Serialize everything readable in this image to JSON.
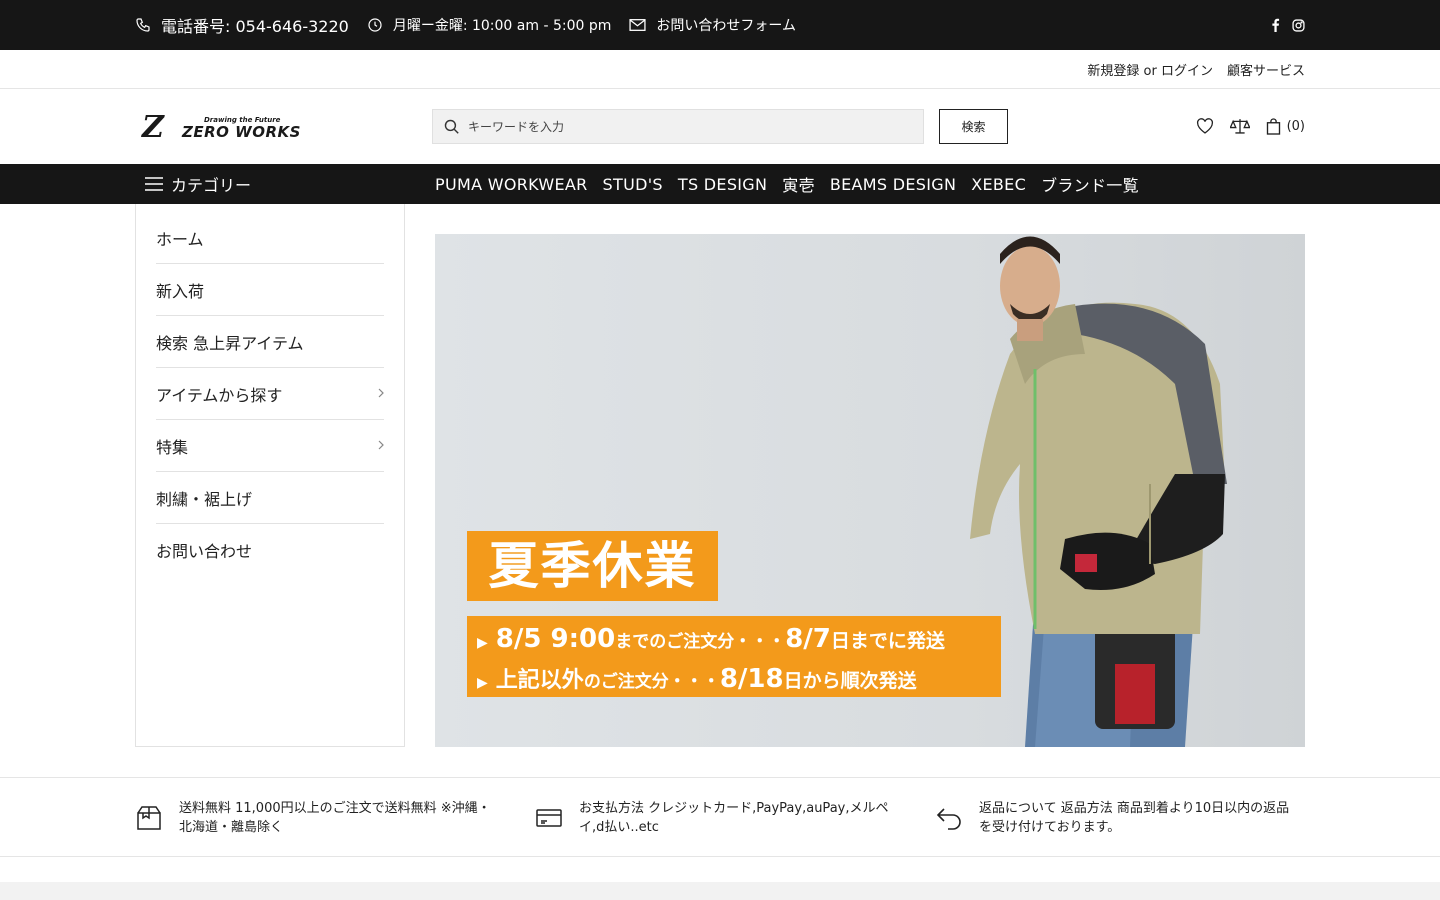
{
  "topbar": {
    "phone": "電話番号: 054-646-3220",
    "hours": "月曜ー金曜: 10:00 am - 5:00 pm",
    "contact": "お問い合わせフォーム"
  },
  "account": {
    "register_login": "新規登録 or ログイン",
    "customer_service": "顧客サービス"
  },
  "logo": {
    "tagline": "Drawing the Future",
    "wordmark": "ZERO WORKS",
    "mark": "Z"
  },
  "search": {
    "placeholder": "キーワードを入力",
    "button": "検索"
  },
  "cart": {
    "count": "(0)"
  },
  "nav": {
    "category_label": "カテゴリー",
    "links": [
      "PUMA WORKWEAR",
      "STUD'S",
      "TS DESIGN",
      "寅壱",
      "BEAMS DESIGN",
      "XEBEC",
      "ブランド一覧"
    ]
  },
  "sidebar": {
    "items": [
      {
        "label": "ホーム"
      },
      {
        "label": "新入荷"
      },
      {
        "label": "検索 急上昇アイテム"
      },
      {
        "label": "アイテムから探す"
      },
      {
        "label": "特集"
      },
      {
        "label": "刺繍・裾上げ"
      },
      {
        "label": "お問い合わせ"
      }
    ]
  },
  "banner": {
    "title": "夏季休業",
    "line1_a": "8/5 9:00",
    "line1_b": "までのご注文分・・・",
    "line1_c": "8/7",
    "line1_d": "日までに発送",
    "line2_a": "上記以外",
    "line2_b": "のご注文分・・・",
    "line2_c": "8/18",
    "line2_d": "日から順次発送",
    "accent_color": "#f39a1b"
  },
  "features": [
    {
      "text": "送料無料 11,000円以上のご注文で送料無料 ※沖縄・北海道・離島除く"
    },
    {
      "text": "お支払方法 クレジットカード,PayPay,auPay,メルペイ,d払い..etc"
    },
    {
      "text": "返品について 返品方法 商品到着より10日以内の返品を受け付けております。"
    }
  ]
}
